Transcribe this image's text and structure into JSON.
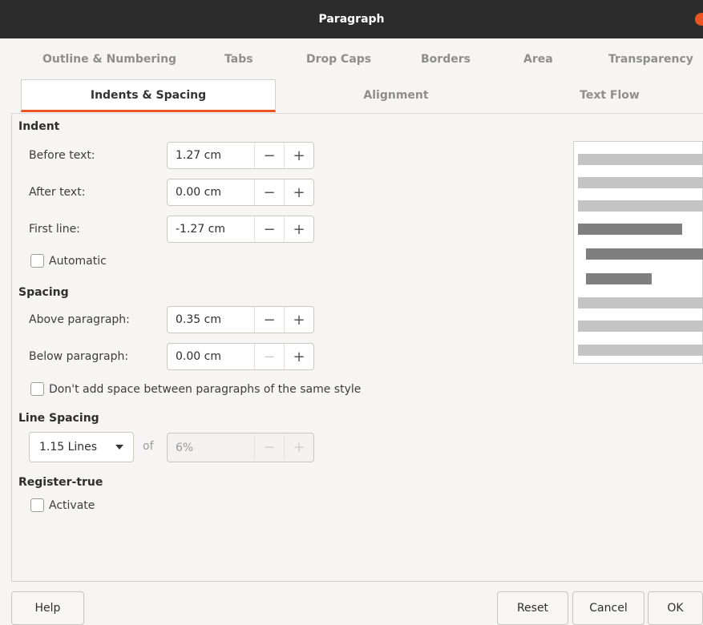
{
  "window": {
    "title": "Paragraph"
  },
  "tabs_row1": [
    "Outline & Numbering",
    "Tabs",
    "Drop Caps",
    "Borders",
    "Area",
    "Transparency"
  ],
  "tabs_row2": [
    "Indents & Spacing",
    "Alignment",
    "Text Flow"
  ],
  "active_tab": "Indents & Spacing",
  "indent": {
    "heading": "Indent",
    "before_text_label": "Before text:",
    "before_text_value": "1.27 cm",
    "after_text_label": "After text:",
    "after_text_value": "0.00 cm",
    "first_line_label": "First line:",
    "first_line_value": "-1.27 cm",
    "automatic_label": "Automatic"
  },
  "spacing": {
    "heading": "Spacing",
    "above_label": "Above paragraph:",
    "above_value": "0.35 cm",
    "below_label": "Below paragraph:",
    "below_value": "0.00 cm",
    "no_space_label": "Don't add space between paragraphs of the same style"
  },
  "line_spacing": {
    "heading": "Line Spacing",
    "mode": "1.15 Lines",
    "of_label": "of",
    "value": "6%"
  },
  "register_true": {
    "heading": "Register-true",
    "activate_label": "Activate"
  },
  "buttons": {
    "help": "Help",
    "reset": "Reset",
    "cancel": "Cancel",
    "ok": "OK"
  },
  "glyphs": {
    "minus": "−",
    "plus": "+"
  },
  "colors": {
    "accent": "#e95420",
    "titlebar": "#2c2c2c"
  }
}
